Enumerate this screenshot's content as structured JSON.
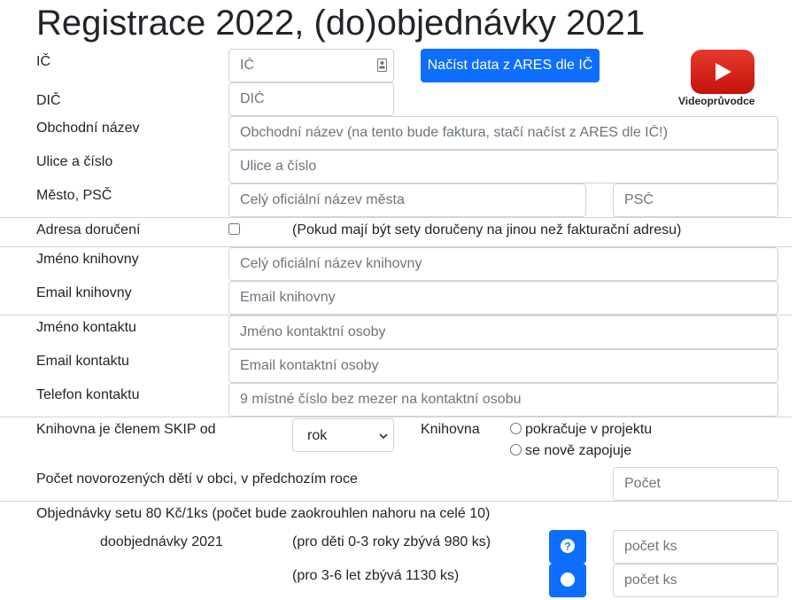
{
  "page": {
    "title": "Registrace 2022, (do)objednávky 2021",
    "video_guide_label": "Videoprůvodce"
  },
  "company": {
    "ic_label": "IČ",
    "ic_placeholder": "IČ",
    "ares_button": "Načíst data z ARES dle IČ",
    "dic_label": "DIČ",
    "dic_placeholder": "DIČ",
    "name_label": "Obchodní název",
    "name_placeholder": "Obchodní název (na tento bude faktura, stačí načíst z ARES dle IČ!)",
    "street_label": "Ulice a číslo",
    "street_placeholder": "Ulice a číslo",
    "city_label": "Město, PSČ",
    "city_placeholder": "Celý oficiální název města",
    "zip_placeholder": "PSČ"
  },
  "delivery": {
    "label": "Adresa doručení",
    "note": "(Pokud mají být sety doručeny na jinou než fakturační adresu)"
  },
  "library": {
    "name_label": "Jméno knihovny",
    "name_placeholder": "Celý oficiální název knihovny",
    "email_label": "Email knihovny",
    "email_placeholder": "Email knihovny"
  },
  "contact": {
    "name_label": "Jméno kontaktu",
    "name_placeholder": "Jméno kontaktní osoby",
    "email_label": "Email kontaktu",
    "email_placeholder": "Email kontaktní osoby",
    "phone_label": "Telefon kontaktu",
    "phone_placeholder": "9 místné číslo bez mezer na kontaktní osobu"
  },
  "skip": {
    "member_label": "Knihovna je členem SKIP od",
    "year_selected": "rok",
    "library_label": "Knihovna",
    "radio_continues": "pokračuje v projektu",
    "radio_new": "se nově zapojuje"
  },
  "births": {
    "label": "Počet novorozených dětí v obci, v předchozím roce",
    "placeholder": "Počet"
  },
  "orders": {
    "header": "Objednávky setu 80 Kč/1ks (počet bude zaokrouhlen nahoru na celé 10)",
    "reorder_label": "doobjednávky 2021",
    "age_0_3": "(pro děti 0-3 roky zbývá 980 ks)",
    "age_3_6": "(pro 3-6 let zbývá 1130 ks)",
    "count_placeholder": "počet ks"
  },
  "colors": {
    "primary": "#0d6efd",
    "youtube_red": "#e62117"
  }
}
